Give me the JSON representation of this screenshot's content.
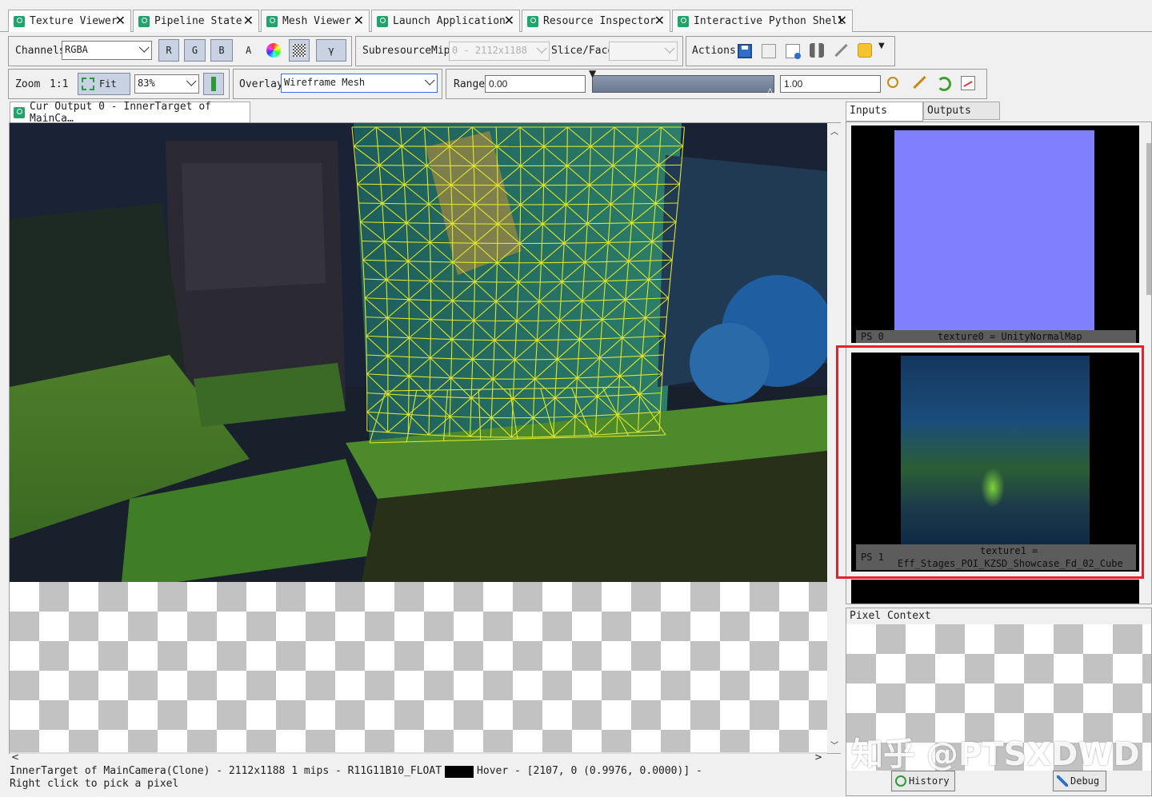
{
  "doc_tabs": [
    {
      "label": "Texture Viewer",
      "active": true
    },
    {
      "label": "Pipeline State"
    },
    {
      "label": "Mesh Viewer"
    },
    {
      "label": "Launch Application"
    },
    {
      "label": "Resource Inspector"
    },
    {
      "label": "Interactive Python Shell"
    }
  ],
  "close_glyph": "✕",
  "toolbar1": {
    "channels_label": "Channels",
    "channels_value": "RGBA",
    "r": "R",
    "g": "G",
    "b": "B",
    "a": "A",
    "gamma": "γ",
    "subresource_label": "Subresource",
    "mip_label": "Mip",
    "mip_value": "0 - 2112x1188",
    "slice_label": "Slice/Face",
    "slice_value": "",
    "actions_label": "Actions"
  },
  "toolbar2": {
    "zoom_label": "Zoom",
    "zoom_1to1": "1:1",
    "fit_label": "Fit",
    "zoom_value": "83%",
    "overlay_label": "Overlay",
    "overlay_value": "Wireframe Mesh",
    "range_label": "Range",
    "range_min": "0.00",
    "range_max": "1.00"
  },
  "view_tab": "Cur Output 0 - InnerTarget of MainCa…",
  "side_tabs": {
    "inputs": "Inputs",
    "outputs": "Outputs"
  },
  "thumbs": [
    {
      "slot": "PS 0",
      "name": "texture0 = UnityNormalMap",
      "color": "#8080ff"
    },
    {
      "slot": "PS 1",
      "name_line1": "texture1 =",
      "name_line2": "Eff_Stages_POI_KZSD_Showcase_Fd_02_Cube"
    }
  ],
  "pixel_context": {
    "title": "Pixel Context",
    "history_label": "History",
    "debug_label": "Debug"
  },
  "status": {
    "line1": "InnerTarget of MainCamera(Clone) - 2112x1188 1 mips - R11G11B10_FLOAT",
    "hover": "Hover - [2107,    0 (0.9976, 0.0000)] -",
    "line2": "Right click to pick a pixel"
  },
  "watermark": "知乎 @PTSXDWD",
  "colors": {
    "tab_icon": "#1fa56a",
    "highlight": "#e8212a",
    "normal_map": "#8080ff",
    "wire": "#e8ec2a"
  }
}
